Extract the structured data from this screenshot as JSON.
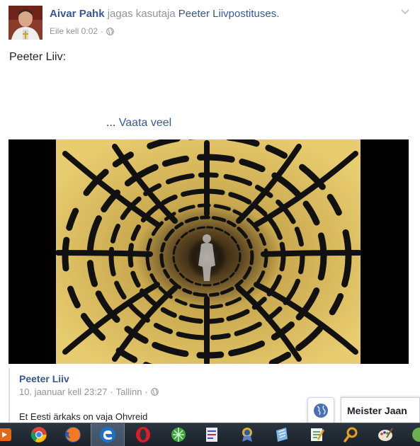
{
  "post": {
    "author": "Aivar Pahk",
    "shared_text": "jagas kasutaja",
    "shared_from": "Peeter Liiv",
    "shared_suffix": "postituses.",
    "timestamp": "Eile kell 0:02",
    "meta_separator": "·",
    "text": "Peeter Liiv:",
    "see_more_prefix": "...",
    "see_more": "Vaata veel"
  },
  "attachment": {
    "name": "Peeter Liiv",
    "timestamp": "10. jaanuar kell 23:27",
    "separator": "·",
    "location": "Tallinn",
    "separator2": "·",
    "text": "Et Eesti ärkaks on vaja Ohvreid"
  },
  "chat": {
    "tab_label": "Meister Jaan"
  },
  "taskbar": {
    "icons": [
      "media-player-icon",
      "chrome-icon",
      "firefox-icon",
      "edge-icon",
      "opera-icon",
      "network-icon",
      "pdf-icon",
      "award-icon",
      "notes-icon",
      "editor-icon",
      "search-icon",
      "paint-icon",
      "app-icon"
    ]
  },
  "colors": {
    "link": "#365899",
    "meta": "#90949c",
    "taskbar": "#1f2830"
  }
}
